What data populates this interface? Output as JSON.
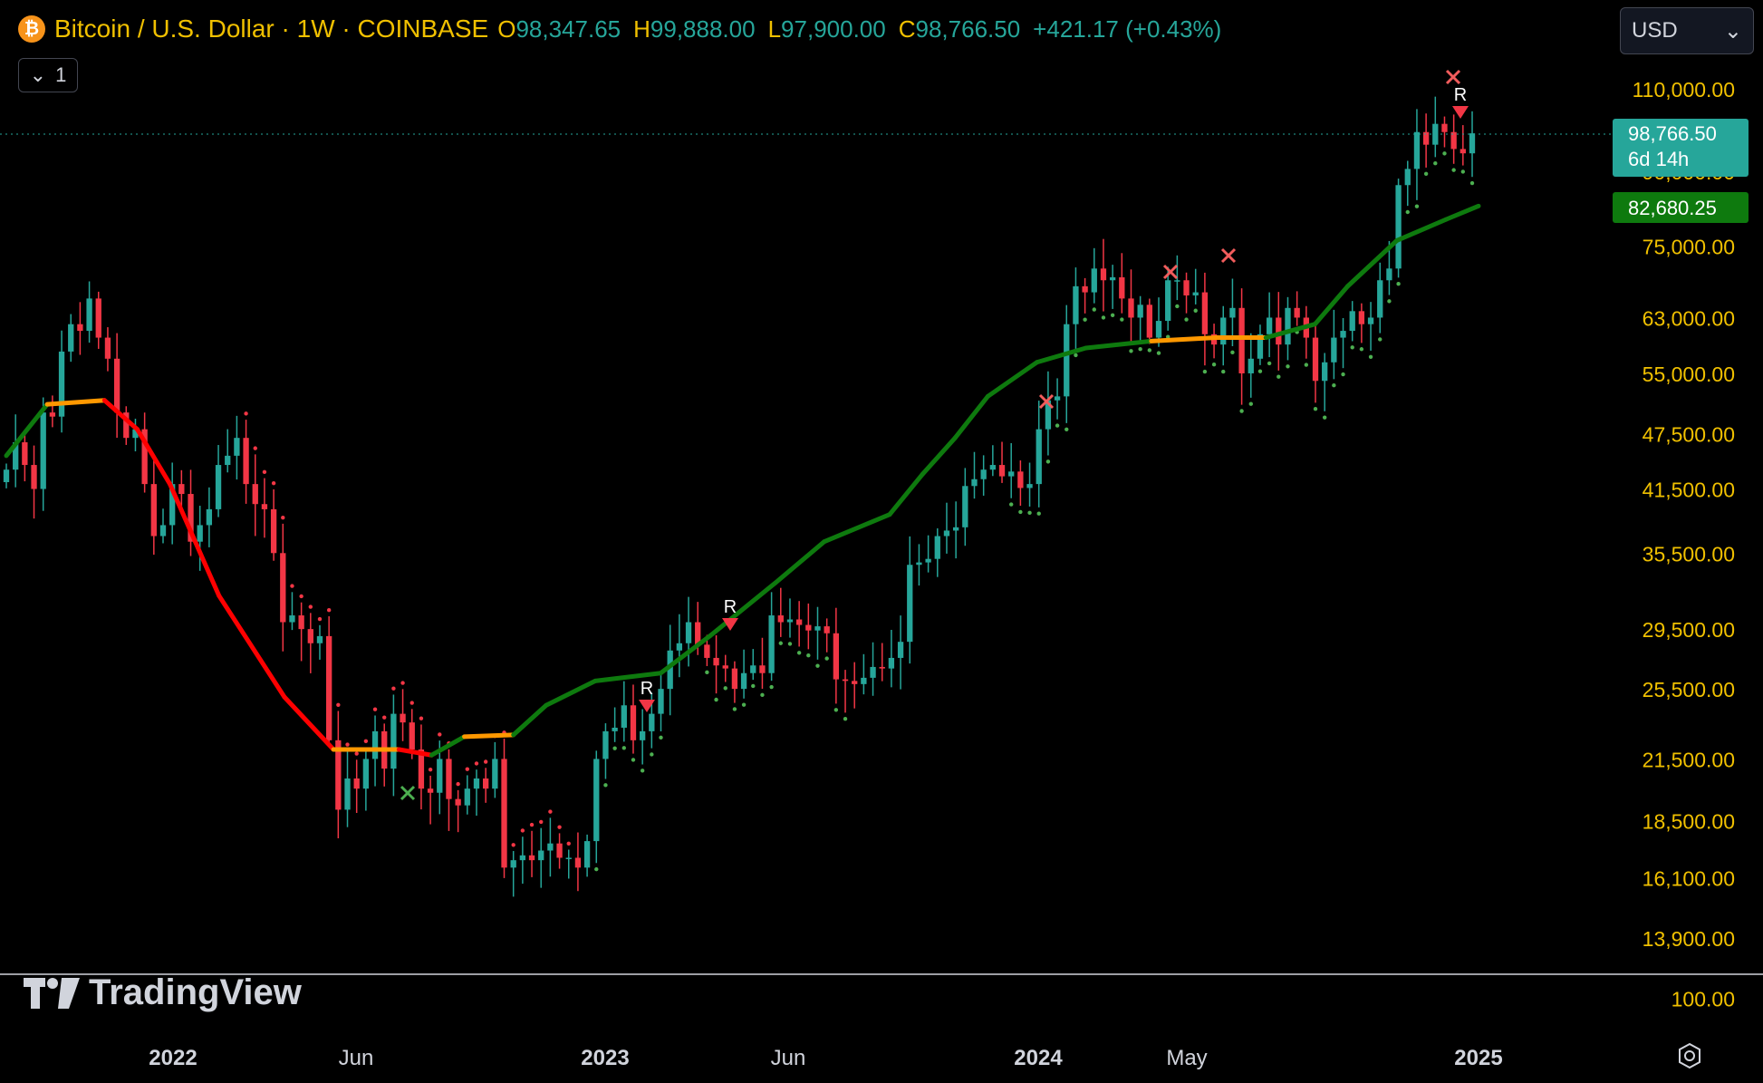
{
  "header": {
    "title": "Bitcoin / U.S. Dollar · 1W · COINBASE",
    "open_label": "O",
    "open": "98,347.65",
    "high_label": "H",
    "high": "99,888.00",
    "low_label": "L",
    "low": "97,900.00",
    "close_label": "C",
    "close": "98,766.50",
    "change": "+421.17 (+0.43%)",
    "collapse_count": "1"
  },
  "currency": {
    "value": "USD"
  },
  "price_badge": {
    "price": "98,766.50",
    "countdown": "6d 14h"
  },
  "indicator_badge": {
    "value": "82,680.25"
  },
  "brand": "TradingView",
  "chart_data": {
    "type": "candlestick",
    "y_scale": "log",
    "yticks": [
      "110,000.00",
      "90,000.00",
      "75,000.00",
      "63,000.00",
      "55,000.00",
      "47,500.00",
      "41,500.00",
      "35,500.00",
      "29,500.00",
      "25,500.00",
      "21,500.00",
      "18,500.00",
      "16,100.00",
      "13,900.00",
      "100.00"
    ],
    "ytick_values": [
      110000,
      90000,
      75000,
      63000,
      55000,
      47500,
      41500,
      35500,
      29500,
      25500,
      21500,
      18500,
      16100,
      13900,
      12000
    ],
    "xticks": [
      "2022",
      "Jun",
      "2023",
      "Jun",
      "2024",
      "May",
      "2025"
    ],
    "xtick_bold": [
      true,
      false,
      true,
      false,
      true,
      false,
      true
    ],
    "colors": {
      "up": "#26a69a",
      "down": "#f23645",
      "trail_bear": "#ff0000",
      "trail_bull": "#0e7a0e",
      "trail_flat": "#ff9800",
      "dot": "#4caf50"
    },
    "close_series": [
      43500,
      46500,
      44000,
      41500,
      50000,
      49500,
      58000,
      62000,
      61000,
      66000,
      60000,
      57000,
      50000,
      47000,
      48000,
      42000,
      37000,
      38000,
      42000,
      41000,
      36500,
      38000,
      39500,
      44000,
      45000,
      47000,
      42000,
      40000,
      39500,
      35500,
      30000,
      30500,
      29500,
      28500,
      29000,
      22500,
      19000,
      20500,
      20000,
      21500,
      23000,
      21000,
      24000,
      23500,
      22000,
      20000,
      19800,
      21500,
      19500,
      19200,
      20000,
      20500,
      20000,
      21500,
      16500,
      16800,
      17000,
      16800,
      17200,
      17500,
      16900,
      16900,
      16500,
      17600,
      21500,
      23000,
      23200,
      24500,
      22500,
      23000,
      24000,
      25500,
      28000,
      28500,
      30000,
      28400,
      27500,
      27000,
      26800,
      25500,
      26500,
      27000,
      26500,
      30500,
      30000,
      30200,
      29800,
      29400,
      29700,
      29200,
      26100,
      26000,
      25800,
      26200,
      26900,
      26800,
      27500,
      28600,
      34500,
      34700,
      35000,
      37000,
      37500,
      37800,
      41800,
      42500,
      43500,
      44000,
      42800,
      43300,
      41600,
      42000,
      48000,
      51500,
      52000,
      62000,
      68000,
      67000,
      71000,
      69000,
      69500,
      66000,
      63000,
      65000,
      60000,
      62500,
      69000,
      69000,
      66500,
      67000,
      60500,
      59000,
      63000,
      64500,
      55000,
      57000,
      60500,
      63000,
      59000,
      64500,
      63000,
      60000,
      54000,
      56500,
      60000,
      61000,
      64000,
      62000,
      63000,
      69000,
      71000,
      87000,
      90500,
      99000,
      96000,
      101000,
      99000,
      95000,
      94000,
      98700
    ],
    "overlay_points": [
      [
        0,
        45000
      ],
      [
        25,
        51000
      ],
      [
        60,
        51500
      ],
      [
        80,
        48000
      ],
      [
        100,
        42000
      ],
      [
        130,
        32000
      ],
      [
        170,
        25000
      ],
      [
        200,
        22000
      ],
      [
        220,
        22000
      ],
      [
        240,
        22000
      ],
      [
        260,
        21700
      ],
      [
        280,
        22700
      ],
      [
        310,
        22800
      ],
      [
        330,
        24500
      ],
      [
        360,
        26000
      ],
      [
        400,
        26500
      ],
      [
        430,
        29000
      ],
      [
        470,
        33000
      ],
      [
        500,
        36500
      ],
      [
        540,
        39000
      ],
      [
        560,
        43000
      ],
      [
        580,
        47000
      ],
      [
        600,
        52000
      ],
      [
        630,
        56500
      ],
      [
        660,
        58500
      ],
      [
        700,
        59500
      ],
      [
        740,
        60000
      ],
      [
        770,
        60000
      ],
      [
        800,
        62000
      ],
      [
        820,
        68000
      ],
      [
        850,
        76000
      ],
      [
        880,
        80000
      ],
      [
        900,
        82680
      ]
    ],
    "markers": [
      {
        "type": "R",
        "text": "R"
      },
      {
        "type": "R",
        "text": "R"
      },
      {
        "type": "R",
        "text": "R"
      },
      {
        "type": "x-bull"
      },
      {
        "type": "x-bear"
      },
      {
        "type": "x-bear"
      },
      {
        "type": "x-bear"
      },
      {
        "type": "x-bear"
      }
    ]
  }
}
